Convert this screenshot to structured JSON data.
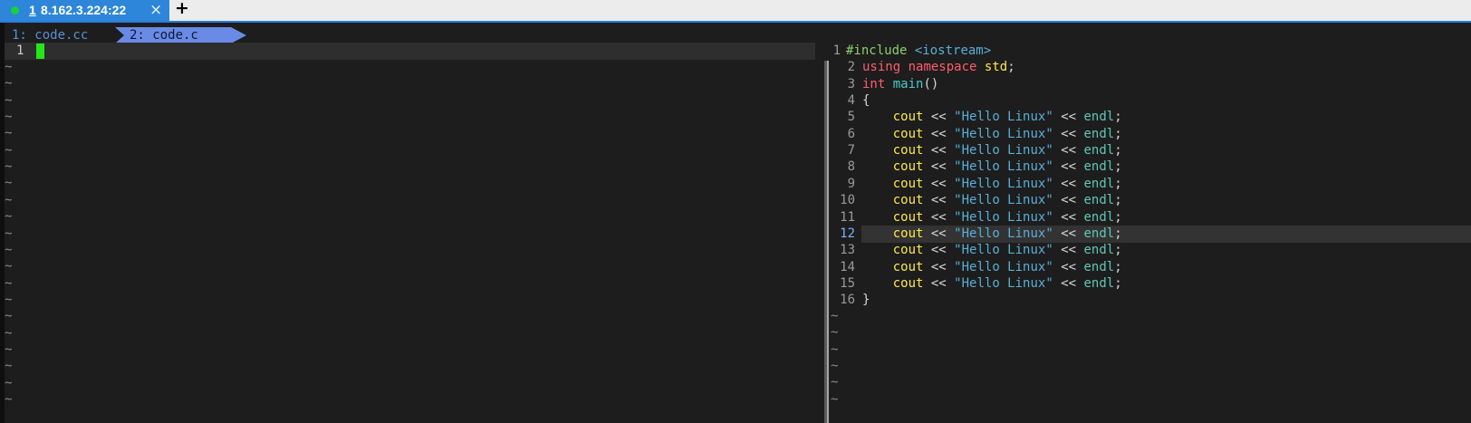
{
  "app_tab": {
    "indicator": "status-dot",
    "index": "1",
    "host": "8.162.3.224:22",
    "close": "×"
  },
  "new_tab": "+",
  "vim": {
    "buffers": [
      "1: code.cc",
      "2: code.c"
    ],
    "left": {
      "line_number": "1",
      "tilde": "~"
    },
    "right": {
      "tilde": "~",
      "line_numbers": [
        "1",
        "2",
        "3",
        "4",
        "5",
        "6",
        "7",
        "8",
        "9",
        "10",
        "11",
        "12",
        "13",
        "14",
        "15",
        "16"
      ],
      "include": {
        "directive": "#include",
        "header": "<iostream>"
      },
      "using": {
        "kw1": "using",
        "kw2": "namespace",
        "ns": "std",
        "semi": ";"
      },
      "main": {
        "type": "int",
        "name": "main",
        "parens": "()"
      },
      "open_brace": "{",
      "close_brace": "}",
      "cout_stmt": {
        "cout": "cout",
        "op": "<<",
        "str": "\"Hello Linux\"",
        "endl": "endl",
        "semi": ";"
      }
    }
  },
  "colors": {
    "tab_active": "#2d86d9",
    "status_dot": "#19d13b",
    "buffer_active_bg": "#6a8be5",
    "cursor": "#22e818",
    "background": "#1d1d1d",
    "keyword": "#ff5c6e",
    "string": "#5aaed7",
    "identifier": "#ffe84d",
    "function": "#4fc8c8"
  }
}
